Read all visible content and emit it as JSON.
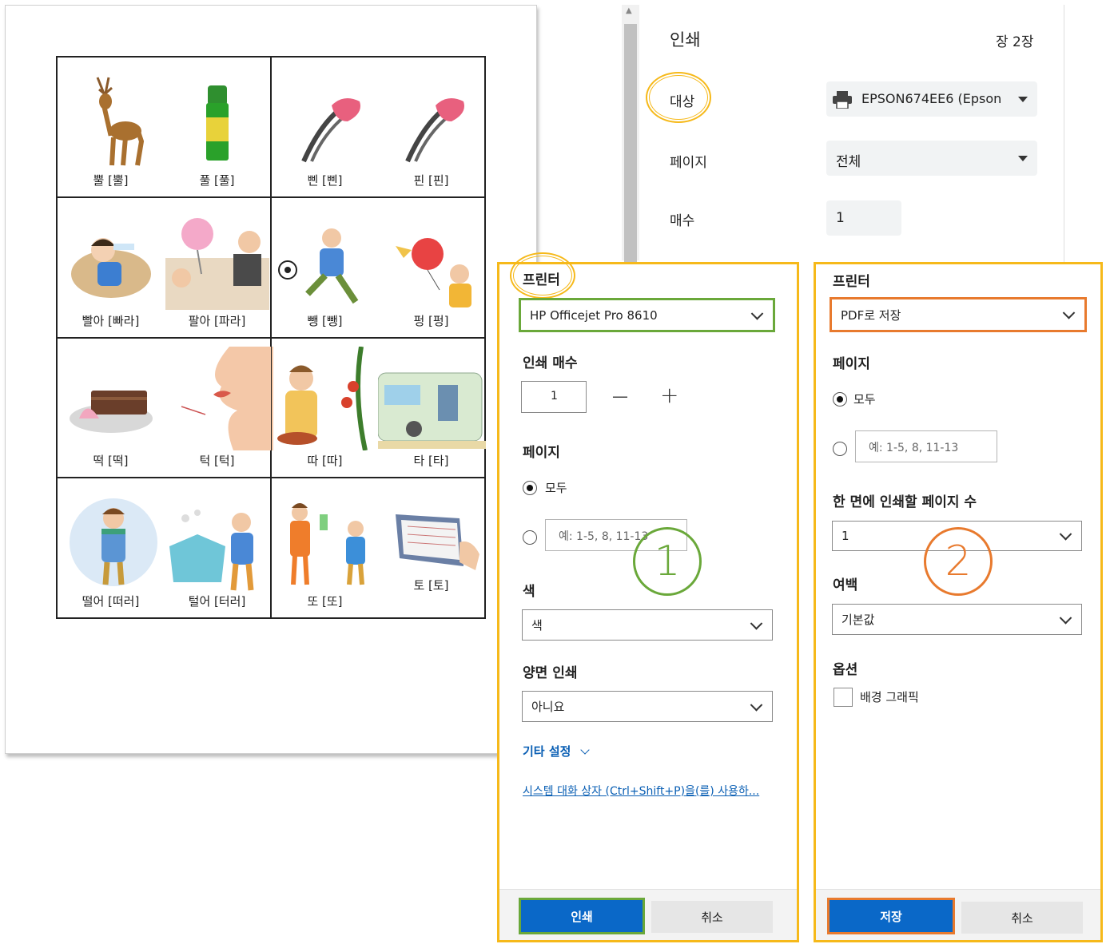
{
  "preview": {
    "cards": [
      {
        "left": "뿔 [뿔]",
        "right": "풀 [풀]"
      },
      {
        "left": "삔 [삔]",
        "right": "핀 [핀]"
      },
      {
        "left": "빨아 [빠라]",
        "right": "팔아 [파라]"
      },
      {
        "left": "뺑 [뺑]",
        "right": "펑 [펑]"
      },
      {
        "left": "떡 [떡]",
        "right": "턱 [턱]"
      },
      {
        "left": "따 [따]",
        "right": "타 [타]"
      },
      {
        "left": "떨어 [떠러]",
        "right": "털어 [터러]"
      },
      {
        "left": "또 [또]",
        "right": "토 [토]"
      }
    ]
  },
  "chrome": {
    "title": "인쇄",
    "sheet_count": "장 2장",
    "dest_label": "대상",
    "dest_value": "EPSON674EE6 (Epson",
    "pages_label": "페이지",
    "pages_value": "전체",
    "copies_label": "매수",
    "copies_value": "1"
  },
  "dialog1": {
    "printer_label": "프린터",
    "printer_value": "HP Officejet Pro 8610",
    "copies_label": "인쇄 매수",
    "copies_value": "1",
    "minus": "—",
    "plus": "+",
    "pages_label": "페이지",
    "pages_all": "모두",
    "pages_placeholder": "예: 1-5, 8, 11-13",
    "color_label": "색",
    "color_value": "색",
    "duplex_label": "양면 인쇄",
    "duplex_value": "아니요",
    "more_settings": "기타 설정",
    "system_dialog": "시스템 대화 상자 (Ctrl+Shift+P)을(를) 사용하...",
    "print_btn": "인쇄",
    "cancel_btn": "취소",
    "badge": "①"
  },
  "dialog2": {
    "printer_label": "프린터",
    "printer_value": "PDF로 저장",
    "pages_label": "페이지",
    "pages_all": "모두",
    "pages_placeholder": "예: 1-5, 8, 11-13",
    "per_sheet_label": "한 면에 인쇄할 페이지 수",
    "per_sheet_value": "1",
    "margins_label": "여백",
    "margins_value": "기본값",
    "options_label": "옵션",
    "bg_graphics": "배경 그래픽",
    "save_btn": "저장",
    "cancel_btn": "취소",
    "badge": "②"
  },
  "colors": {
    "highlight_yellow": "#f6b91a",
    "highlight_green": "#6aa83a",
    "highlight_orange": "#e87a2e",
    "primary_blue": "#0a68c8"
  }
}
